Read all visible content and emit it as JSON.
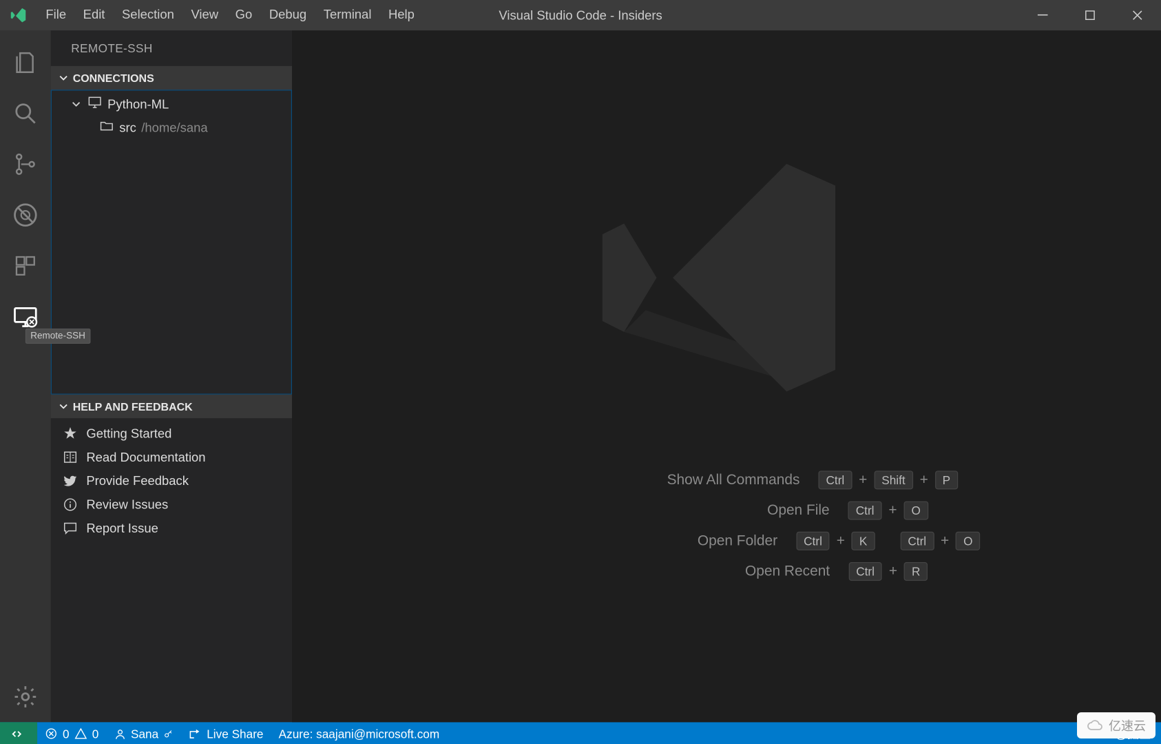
{
  "window": {
    "title": "Visual Studio Code - Insiders"
  },
  "menu": {
    "items": [
      "File",
      "Edit",
      "Selection",
      "View",
      "Go",
      "Debug",
      "Terminal",
      "Help"
    ]
  },
  "activitybar": {
    "items": [
      {
        "name": "explorer",
        "icon": "files-icon"
      },
      {
        "name": "search",
        "icon": "search-icon"
      },
      {
        "name": "source-control",
        "icon": "scm-icon"
      },
      {
        "name": "debug",
        "icon": "debug-icon"
      },
      {
        "name": "extensions",
        "icon": "extensions-icon"
      },
      {
        "name": "remote",
        "icon": "remote-icon",
        "active": true,
        "tooltip": "Remote-SSH"
      }
    ],
    "bottom": {
      "name": "settings",
      "icon": "gear-icon"
    }
  },
  "sidebar": {
    "title": "REMOTE-SSH",
    "connections": {
      "header": "CONNECTIONS",
      "tree": {
        "host": "Python-ML",
        "folder": {
          "name": "src",
          "path": "/home/sana"
        }
      }
    },
    "help": {
      "header": "HELP AND FEEDBACK",
      "items": [
        {
          "icon": "star-icon",
          "label": "Getting Started"
        },
        {
          "icon": "book-icon",
          "label": "Read Documentation"
        },
        {
          "icon": "twitter-icon",
          "label": "Provide Feedback"
        },
        {
          "icon": "info-icon",
          "label": "Review Issues"
        },
        {
          "icon": "comment-icon",
          "label": "Report Issue"
        }
      ]
    }
  },
  "editor": {
    "shortcuts": [
      {
        "label": "Show All Commands",
        "keys": [
          [
            "Ctrl",
            "Shift",
            "P"
          ]
        ]
      },
      {
        "label": "Open File",
        "keys": [
          [
            "Ctrl",
            "O"
          ]
        ]
      },
      {
        "label": "Open Folder",
        "keys": [
          [
            "Ctrl",
            "K"
          ],
          [
            "Ctrl",
            "O"
          ]
        ]
      },
      {
        "label": "Open Recent",
        "keys": [
          [
            "Ctrl",
            "R"
          ]
        ]
      }
    ]
  },
  "statusbar": {
    "errors": "0",
    "warnings": "0",
    "user": "Sana",
    "liveshare": "Live Share",
    "azure": "Azure: saajani@microsoft.com",
    "rightText": "@掘金",
    "watermark": "亿速云"
  }
}
